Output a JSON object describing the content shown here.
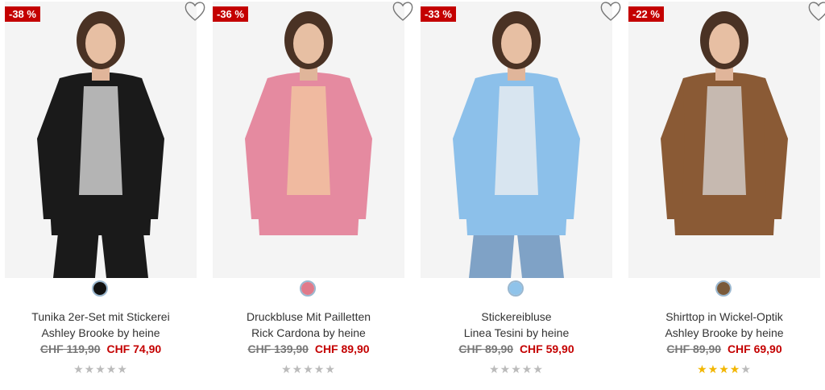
{
  "products": [
    {
      "badge": "-38 %",
      "title": "Tunika 2er-Set mit Stickerei",
      "brand": "Ashley Brooke by heine",
      "old_price": "CHF 119,90",
      "new_price": "CHF 74,90",
      "rating": 0,
      "swatch_color": "#111111",
      "garment_color": "#1a1a1a",
      "accent_color": "#e8e8e8",
      "pants_color": "#1a1a1a"
    },
    {
      "badge": "-36 %",
      "title": "Druckbluse Mit Pailletten",
      "brand": "Rick Cardona by heine",
      "old_price": "CHF 139,90",
      "new_price": "CHF 89,90",
      "rating": 0,
      "swatch_color": "#e07a8a",
      "garment_color": "#e58aa0",
      "accent_color": "#f3c9a0",
      "pants_color": "#f4f4f4"
    },
    {
      "badge": "-33 %",
      "title": "Stickereibluse",
      "brand": "Linea Tesini by heine",
      "old_price": "CHF 89,90",
      "new_price": "CHF 59,90",
      "rating": 0,
      "swatch_color": "#8fc3ea",
      "garment_color": "#8cc0ea",
      "accent_color": "#f2f2f2",
      "pants_color": "#7fa2c6"
    },
    {
      "badge": "-22 %",
      "title": "Shirttop in Wickel-Optik",
      "brand": "Ashley Brooke by heine",
      "old_price": "CHF 89,90",
      "new_price": "CHF 69,90",
      "rating": 4,
      "swatch_color": "#7a5a3a",
      "garment_color": "#8a5a35",
      "accent_color": "#d9d9d9",
      "pants_color": "#f4f4f4"
    }
  ]
}
